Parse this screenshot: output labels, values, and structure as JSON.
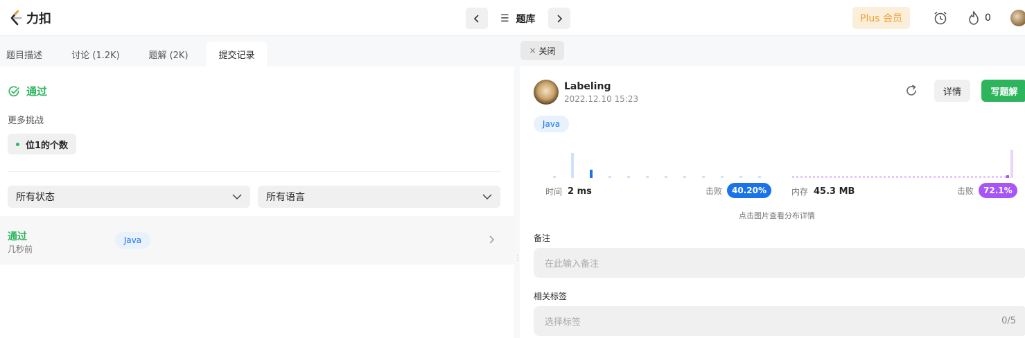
{
  "brand": {
    "name": "力扣"
  },
  "header": {
    "problem_list_label": "题库",
    "plus_label": "Plus 会员",
    "streak_count": "0"
  },
  "left": {
    "tabs": [
      {
        "label": "题目描述",
        "active": false
      },
      {
        "label": "讨论 (1.2K)",
        "active": false
      },
      {
        "label": "题解 (2K)",
        "active": false
      },
      {
        "label": "提交记录",
        "active": true
      }
    ],
    "result_title": "通过",
    "more_challenges_label": "更多挑战",
    "challenge_item": "位1的个数",
    "filters": {
      "status": "所有状态",
      "language": "所有语言"
    },
    "submissions": [
      {
        "status": "通过",
        "time": "几秒前",
        "language": "Java"
      }
    ]
  },
  "right": {
    "close_label": "关闭",
    "user": {
      "name": "Labeling",
      "submitted_at": "2022.12.10 15:23"
    },
    "detail_label": "详情",
    "write_solution_label": "写题解",
    "language": "Java",
    "runtime": {
      "label": "时间",
      "value": "2 ms",
      "beats_label": "击败",
      "beats": "40.20%"
    },
    "memory": {
      "label": "内存",
      "value": "45.3 MB",
      "beats_label": "击败",
      "beats": "72.1%"
    },
    "chart_hint": "点击图片查看分布详情",
    "notes": {
      "label": "备注",
      "placeholder": "在此输入备注"
    },
    "tags": {
      "label": "相关标签",
      "placeholder": "选择标签",
      "count": "0/5"
    }
  },
  "colors": {
    "accent_green": "#2db55d",
    "runtime_blue": "#1a73e8",
    "memory_purple": "#a855f7",
    "plus_orange": "#f0a030"
  }
}
